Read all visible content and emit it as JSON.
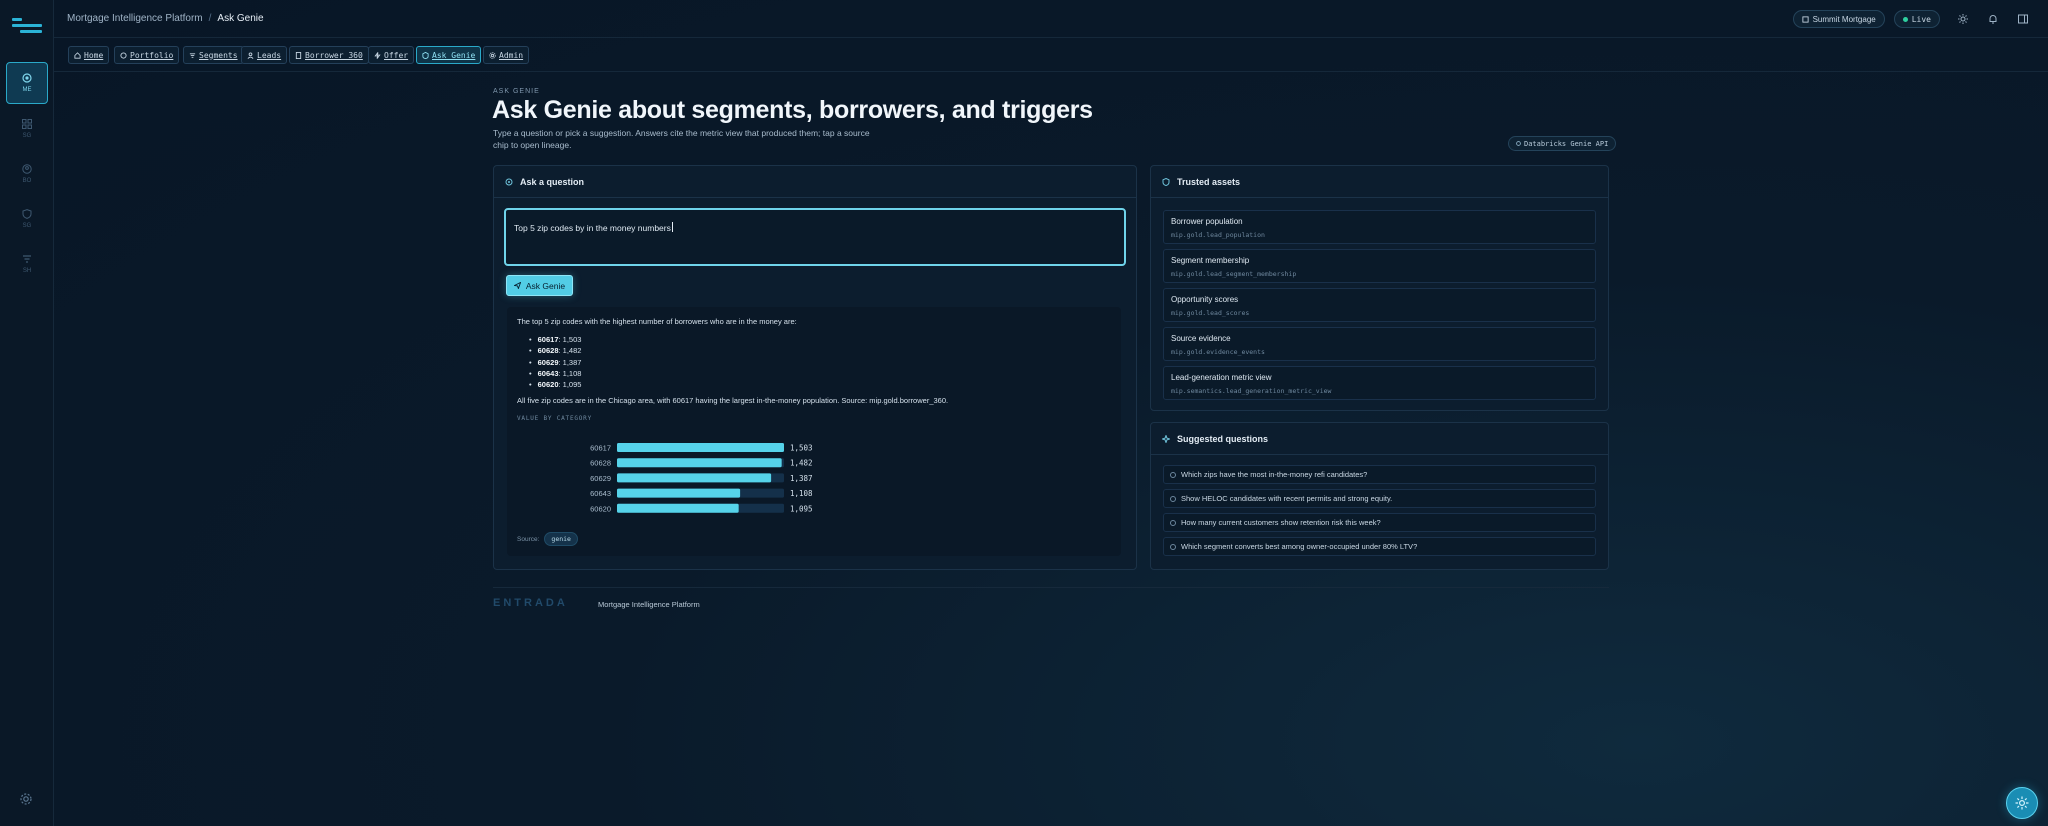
{
  "app": {
    "name": "Mortgage Intelligence Platform",
    "breadcrumb_current": "Ask Genie"
  },
  "rail": {
    "items": [
      {
        "label": "ME",
        "icon": "target-icon",
        "active": true
      },
      {
        "label": "SG",
        "icon": "grid-icon",
        "active": false
      },
      {
        "label": "BO",
        "icon": "user-icon",
        "active": false
      },
      {
        "label": "SG",
        "icon": "shield-icon",
        "active": false
      },
      {
        "label": "SH",
        "icon": "filter-icon",
        "active": false
      }
    ]
  },
  "topbar": {
    "org": "Summit Mortgage",
    "status": "Live"
  },
  "nav": {
    "tabs": [
      {
        "label": "Home",
        "icon": "home-icon"
      },
      {
        "label": "Portfolio",
        "icon": "portfolio-icon"
      },
      {
        "label": "Segments",
        "icon": "segments-icon"
      },
      {
        "label": "Leads",
        "icon": "leads-icon"
      },
      {
        "label": "Borrower 360",
        "icon": "borrower-icon"
      },
      {
        "label": "Offer",
        "icon": "bolt-icon"
      },
      {
        "label": "Ask Genie",
        "icon": "genie-icon",
        "active": true
      },
      {
        "label": "Admin",
        "icon": "admin-icon"
      }
    ]
  },
  "page": {
    "eyebrow": "ASK GENIE",
    "title": "Ask Genie about segments, borrowers, and triggers",
    "subtitle": "Type a question or pick a suggestion. Answers cite the metric view that produced them; tap a source chip to open lineage.",
    "api_badge": "Databricks Genie API"
  },
  "ask": {
    "header": "Ask a question",
    "query": "Top 5 zip codes by in the money numbers",
    "button": "Ask Genie",
    "answer": {
      "intro": "The top 5 zip codes with the highest number of borrowers who are in the money are:",
      "items": [
        {
          "zip": "60617",
          "value": "1,503"
        },
        {
          "zip": "60628",
          "value": "1,482"
        },
        {
          "zip": "60629",
          "value": "1,387"
        },
        {
          "zip": "60643",
          "value": "1,108"
        },
        {
          "zip": "60620",
          "value": "1,095"
        }
      ],
      "summary": "All five zip codes are in the Chicago area, with 60617 having the largest in-the-money population. Source: mip.gold.borrower_360.",
      "chart_label": "VALUE BY CATEGORY",
      "source_label": "Source:",
      "source_chip": "genie"
    }
  },
  "chart_data": {
    "type": "bar",
    "orientation": "horizontal",
    "categories": [
      "60617",
      "60628",
      "60629",
      "60643",
      "60620"
    ],
    "values": [
      1503,
      1482,
      1387,
      1108,
      1095
    ],
    "value_labels": [
      "1,503",
      "1,482",
      "1,387",
      "1,108",
      "1,095"
    ],
    "xlim": [
      0,
      1503
    ],
    "bar_color": "#56d3ea",
    "track_color": "#14304a"
  },
  "assets": {
    "header": "Trusted assets",
    "items": [
      {
        "title": "Borrower population",
        "path": "mip.gold.lead_population"
      },
      {
        "title": "Segment membership",
        "path": "mip.gold.lead_segment_membership"
      },
      {
        "title": "Opportunity scores",
        "path": "mip.gold.lead_scores"
      },
      {
        "title": "Source evidence",
        "path": "mip.gold.evidence_events"
      },
      {
        "title": "Lead-generation metric view",
        "path": "mip.semantics.lead_generation_metric_view"
      }
    ]
  },
  "suggestions": {
    "header": "Suggested questions",
    "items": [
      "Which zips have the most in-the-money refi candidates?",
      "Show HELOC candidates with recent permits and strong equity.",
      "How many current customers show retention risk this week?",
      "Which segment converts best among owner-occupied under 80% LTV?"
    ]
  },
  "footer": {
    "brand": "ENTRADA",
    "name": "Mortgage Intelligence Platform"
  }
}
